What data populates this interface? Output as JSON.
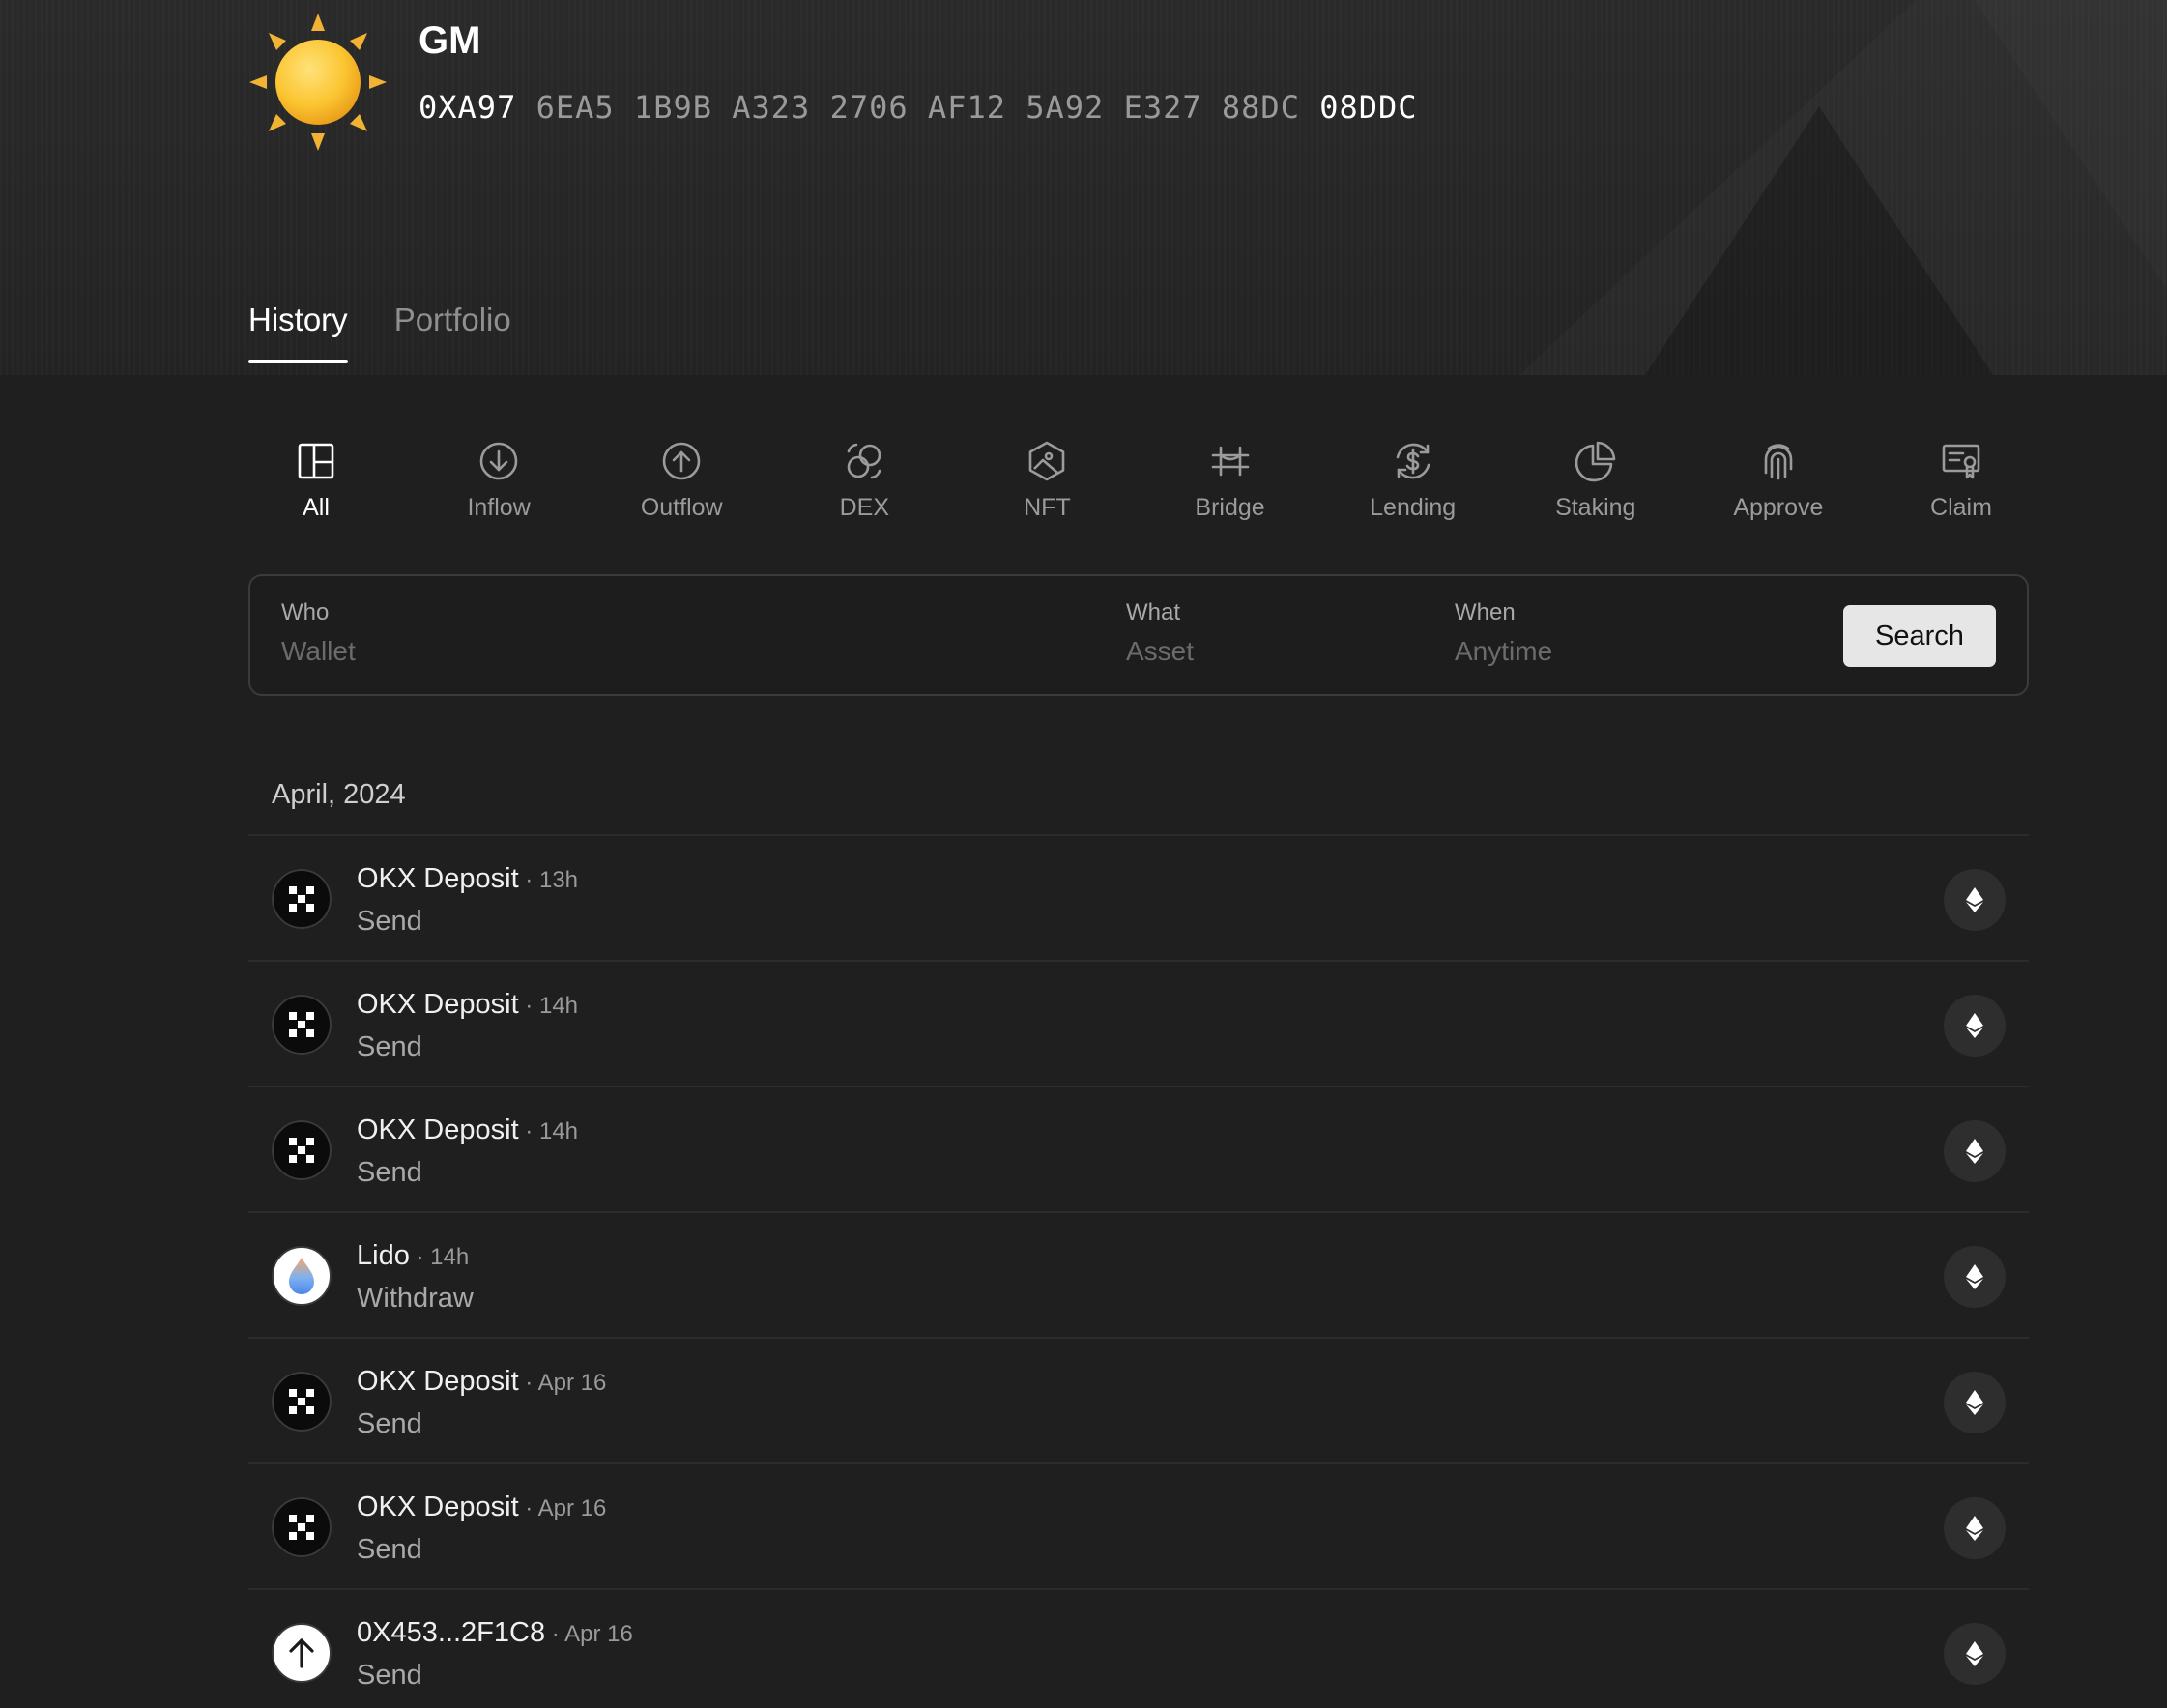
{
  "header": {
    "title": "GM",
    "address": {
      "prefix": "0XA97",
      "middle": " 6EA5 1B9B A323 2706 AF12 5A92 E327 88DC ",
      "suffix": "08DDC"
    }
  },
  "tabs": [
    {
      "label": "History",
      "active": true
    },
    {
      "label": "Portfolio",
      "active": false
    }
  ],
  "filters": [
    {
      "label": "All",
      "icon": "layout-icon",
      "active": true
    },
    {
      "label": "Inflow",
      "icon": "arrow-down-circle-icon"
    },
    {
      "label": "Outflow",
      "icon": "arrow-up-circle-icon"
    },
    {
      "label": "DEX",
      "icon": "swap-coins-icon"
    },
    {
      "label": "NFT",
      "icon": "hexagon-image-icon"
    },
    {
      "label": "Bridge",
      "icon": "bridge-icon"
    },
    {
      "label": "Lending",
      "icon": "dollar-cycle-icon"
    },
    {
      "label": "Staking",
      "icon": "pie-chart-icon"
    },
    {
      "label": "Approve",
      "icon": "fingerprint-icon"
    },
    {
      "label": "Claim",
      "icon": "certificate-icon"
    }
  ],
  "search": {
    "who_label": "Who",
    "who_placeholder": "Wallet",
    "what_label": "What",
    "what_placeholder": "Asset",
    "when_label": "When",
    "when_placeholder": "Anytime",
    "button_label": "Search"
  },
  "activity": {
    "month": "April, 2024",
    "items": [
      {
        "name": "OKX Deposit",
        "time": " · 13h",
        "action": "Send",
        "avatar": "okx-logo-icon",
        "chain": "ethereum-icon"
      },
      {
        "name": "OKX Deposit",
        "time": " · 14h",
        "action": "Send",
        "avatar": "okx-logo-icon",
        "chain": "ethereum-icon"
      },
      {
        "name": "OKX Deposit",
        "time": " · 14h",
        "action": "Send",
        "avatar": "okx-logo-icon",
        "chain": "ethereum-icon"
      },
      {
        "name": "Lido",
        "time": " · 14h",
        "action": "Withdraw",
        "avatar": "lido-logo-icon",
        "chain": "ethereum-icon"
      },
      {
        "name": "OKX Deposit",
        "time": " · Apr 16",
        "action": "Send",
        "avatar": "okx-logo-icon",
        "chain": "ethereum-icon"
      },
      {
        "name": "OKX Deposit",
        "time": " · Apr 16",
        "action": "Send",
        "avatar": "okx-logo-icon",
        "chain": "ethereum-icon"
      },
      {
        "name": "0X453...2F1C8",
        "time": " · Apr 16",
        "action": "Send",
        "avatar": "arrow-up-icon",
        "chain": "ethereum-icon"
      }
    ]
  }
}
